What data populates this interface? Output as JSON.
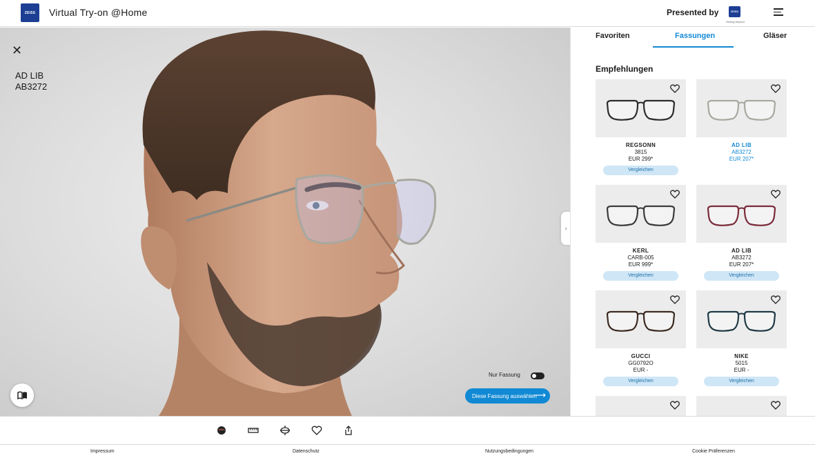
{
  "header": {
    "logo_text": "ZEISS",
    "title": "Virtual Try-on @Home",
    "presented_by": "Presented by",
    "partner_logo_text": "ZEISS",
    "partner_tagline": "Seeing beyond",
    "menu_icon": "hamburger-menu-icon"
  },
  "viewer": {
    "close_icon": "close-icon",
    "frame_brand": "AD LIB",
    "frame_model": "AB3272",
    "nur_fassung_label": "Nur Fassung",
    "select_button": "Diese Fassung auswählen",
    "select_button_icon": "arrow-right-icon",
    "catalog_icon": "open-book-icon"
  },
  "panel": {
    "tabs": [
      "Favoriten",
      "Fassungen",
      "Gläser"
    ],
    "active_tab": "Fassungen",
    "section_title": "Empfehlungen",
    "collapse_icon": "chevron-right-icon",
    "items": [
      {
        "brand": "REGSONN",
        "model": "3815",
        "price": "EUR 299*",
        "compare": "Vergleichen",
        "frame_color": "#2b2b2b",
        "selected": false
      },
      {
        "brand": "AD LIB",
        "model": "AB3272",
        "price": "EUR 207*",
        "compare": "",
        "frame_color": "#a8a8a0",
        "selected": true
      },
      {
        "brand": "KERL",
        "model": "CARB-005",
        "price": "EUR 999*",
        "compare": "Vergleichen",
        "frame_color": "#3a3a3a",
        "selected": false
      },
      {
        "brand": "AD LIB",
        "model": "AB3272",
        "price": "EUR 207*",
        "compare": "Vergleichen",
        "frame_color": "#7a2a3a",
        "selected": false
      },
      {
        "brand": "GUCCI",
        "model": "GG0792O",
        "price": "EUR -",
        "compare": "Vergleichen",
        "frame_color": "#3b2a22",
        "selected": false
      },
      {
        "brand": "NIKE",
        "model": "5015",
        "price": "EUR -",
        "compare": "Vergleichen",
        "frame_color": "#1f3a45",
        "selected": false
      }
    ]
  },
  "toolbar": {
    "icons": [
      "avatar-icon",
      "ruler-icon",
      "lens-compare-icon",
      "heart-icon",
      "share-icon"
    ]
  },
  "footer": {
    "links": [
      "Impressum",
      "Datenschutz",
      "Nutzungsbedingungen",
      "Cookie Präferenzen"
    ]
  },
  "colors": {
    "accent": "#1189d4",
    "compare_bg": "#cfe6f6",
    "zeiss_blue": "#1c3f94"
  }
}
